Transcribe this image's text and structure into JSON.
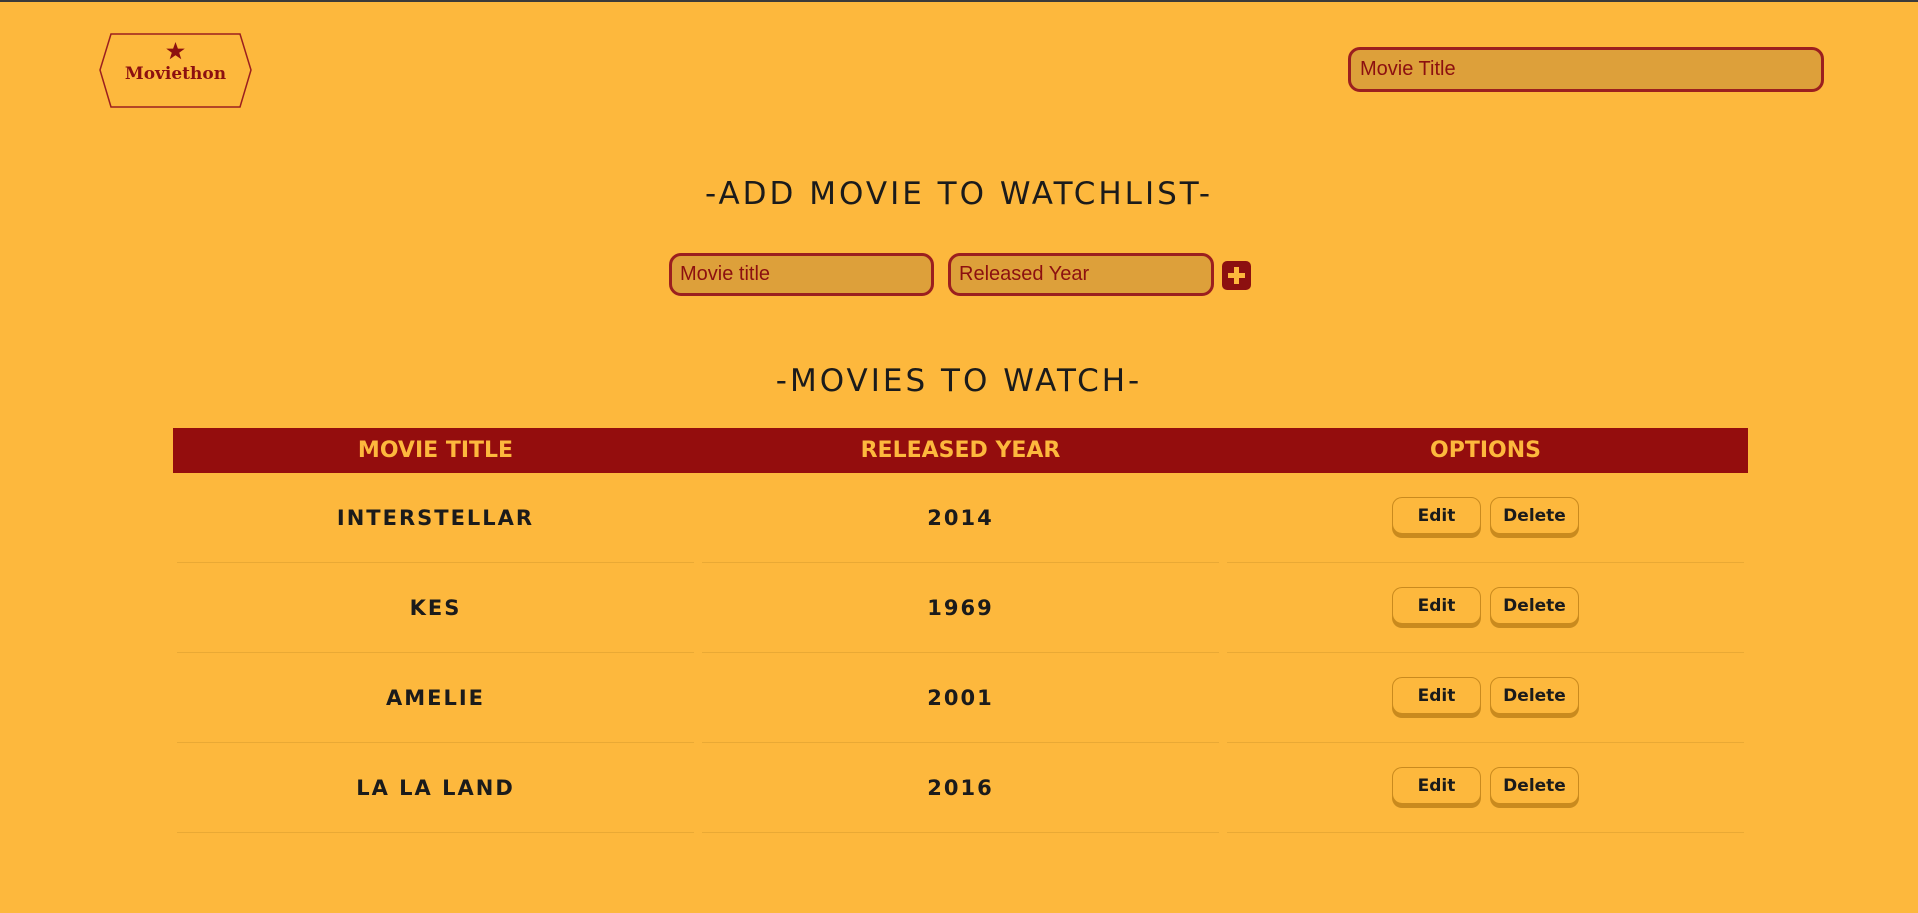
{
  "header": {
    "logo_text": "Moviethon",
    "search_placeholder": "Movie Title"
  },
  "add_section": {
    "heading": "-ADD MOVIE TO WATCHLIST-",
    "title_placeholder": "Movie title",
    "year_placeholder": "Released Year"
  },
  "watch_section": {
    "heading": "-MOVIES TO WATCH-"
  },
  "table": {
    "columns": [
      "MOVIE TITLE",
      "RELEASED YEAR",
      "OPTIONS"
    ],
    "rows": [
      {
        "title": "INTERSTELLAR",
        "year": "2014",
        "edit": "Edit",
        "delete": "Delete"
      },
      {
        "title": "KES",
        "year": "1969",
        "edit": "Edit",
        "delete": "Delete"
      },
      {
        "title": "AMELIE",
        "year": "2001",
        "edit": "Edit",
        "delete": "Delete"
      },
      {
        "title": "LA LA LAND",
        "year": "2016",
        "edit": "Edit",
        "delete": "Delete"
      }
    ]
  },
  "icons": {
    "logo": "star-hexagon-badge-icon",
    "add": "plus-icon"
  },
  "colors": {
    "background": "#FDB83D",
    "accent": "#940D0D",
    "input_fill": "#DDA03A",
    "text": "#1b1b1b"
  }
}
